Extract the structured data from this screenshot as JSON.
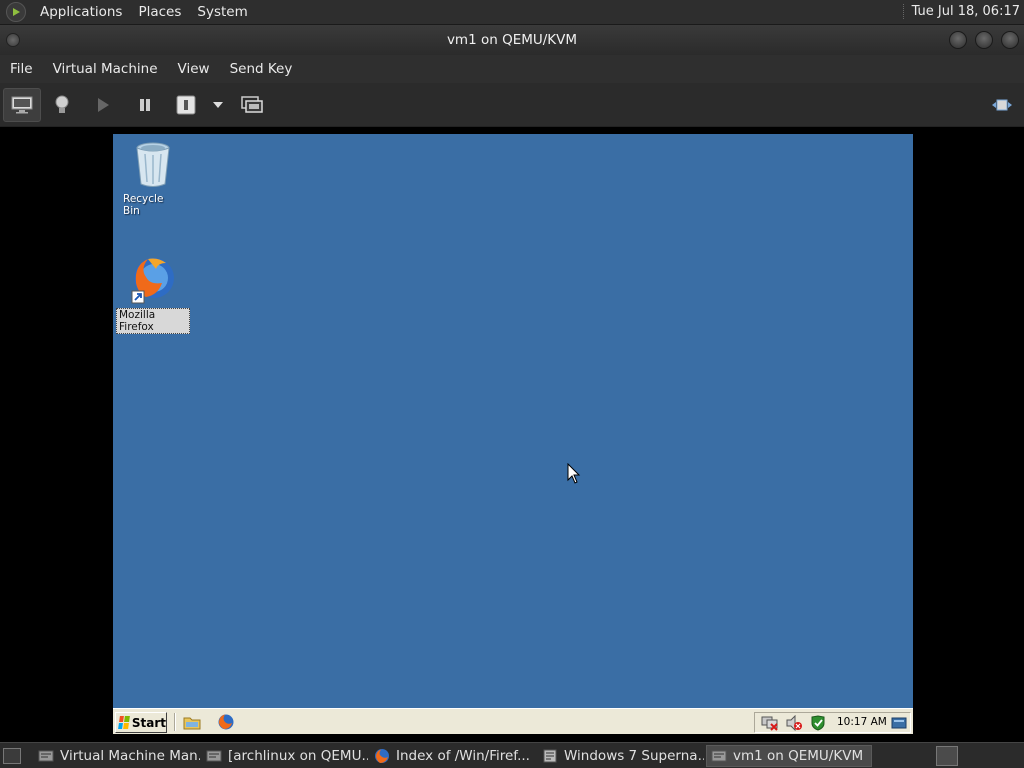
{
  "top_panel": {
    "menus": [
      "Applications",
      "Places",
      "System"
    ],
    "clock": "Tue Jul 18, 06:17"
  },
  "window": {
    "title": "vm1 on QEMU/KVM",
    "menus": [
      "File",
      "Virtual Machine",
      "View",
      "Send Key"
    ]
  },
  "toolbar": {
    "buttons": [
      "console-icon",
      "lightbulb-icon",
      "run-icon",
      "pause-icon",
      "shutdown-icon",
      "shutdown-menu-icon",
      "snapshot-icon",
      "fullscreen-icon"
    ]
  },
  "guest": {
    "background_color": "#3a6ea5",
    "desktop_icons": [
      {
        "label": "Recycle Bin",
        "icon": "recycle-bin-icon"
      },
      {
        "label": "Mozilla Firefox",
        "icon": "firefox-icon",
        "selected": true
      }
    ],
    "taskbar": {
      "start_label": "Start",
      "quick_launch": [
        "show-desktop-icon",
        "firefox-icon"
      ],
      "tray_icons": [
        "network-disconnected-icon",
        "volume-muted-icon",
        "security-shield-icon"
      ],
      "time": "10:17 AM"
    }
  },
  "bottom_panel": {
    "tasks": [
      {
        "label": "Virtual Machine Man...",
        "icon": "virt-manager-icon"
      },
      {
        "label": "[archlinux on QEMU...",
        "icon": "vm-console-icon"
      },
      {
        "label": "Index of /Win/Firef...",
        "icon": "firefox-icon"
      },
      {
        "label": "Windows 7 Superna...",
        "icon": "document-icon"
      },
      {
        "label": "vm1 on QEMU/KVM",
        "icon": "vm-console-icon",
        "active": true
      }
    ]
  }
}
